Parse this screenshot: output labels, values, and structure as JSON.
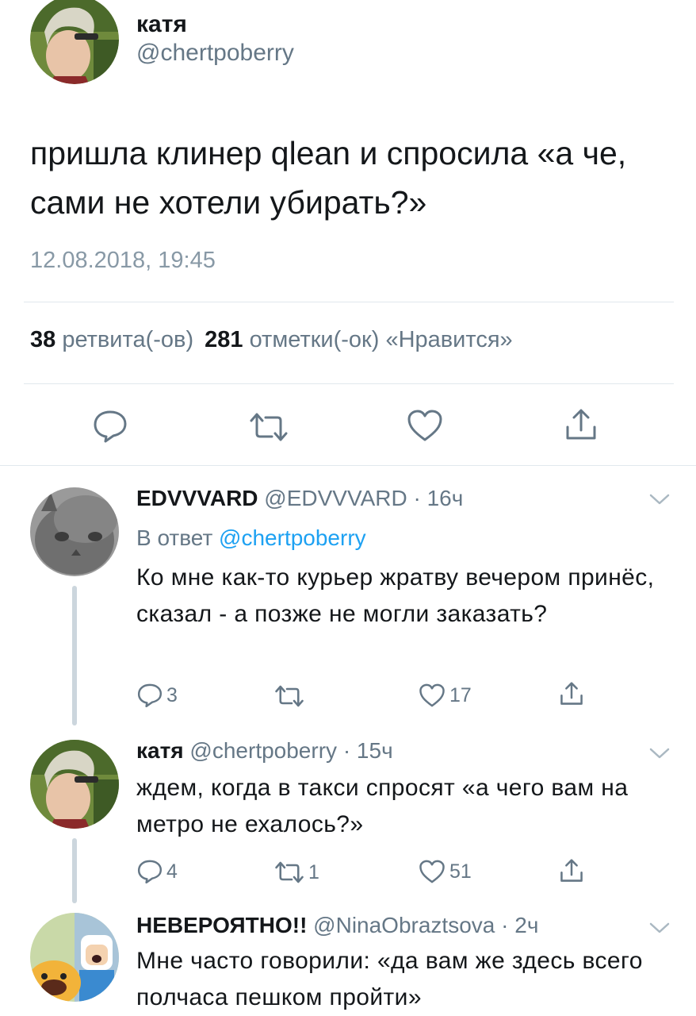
{
  "main_tweet": {
    "author_name": "катя",
    "author_handle": "@chertpoberry",
    "text": "пришла клинер qlean и спросила «а че, сами не хотели убирать?»",
    "timestamp": "12.08.2018, 19:45",
    "stats": {
      "retweets_count": "38",
      "retweets_label": "ретвита(-ов)",
      "likes_count": "281",
      "likes_label": "отметки(-ок) «Нравится»"
    }
  },
  "replies": [
    {
      "author_name": "EDVVVARD",
      "author_handle": "@EDVVVARD",
      "separator": "·",
      "time": "16ч",
      "reply_prefix": "В ответ",
      "reply_to": "@chertpoberry",
      "text": "Ко мне как-то курьер жратву вечером принёс, сказал - а позже не могли заказать?",
      "reply_count": "3",
      "retweet_count": "",
      "like_count": "17"
    },
    {
      "author_name": "катя",
      "author_handle": "@chertpoberry",
      "separator": "·",
      "time": "15ч",
      "text": "ждем, когда в такси спросят «а чего вам на метро не ехалось?»",
      "reply_count": "4",
      "retweet_count": "1",
      "like_count": "51"
    },
    {
      "author_name": "НЕВЕРОЯТНО!!",
      "author_handle": "@NinaObraztsova",
      "separator": "·",
      "time": "2ч",
      "text": "Мне часто говорили: «да вам же здесь всего полчаса пешком пройти»"
    }
  ],
  "icons": {
    "reply": "speech-bubble-icon",
    "retweet": "retweet-arrows-icon",
    "like": "heart-outline-icon",
    "share": "share-upload-icon",
    "more": "chevron-down-icon"
  },
  "colors": {
    "text": "#14171a",
    "secondary": "#657786",
    "muted": "#8899a6",
    "link": "#1da1f2",
    "divider": "#e1e8ed",
    "thread_line": "#ccd6dd"
  }
}
